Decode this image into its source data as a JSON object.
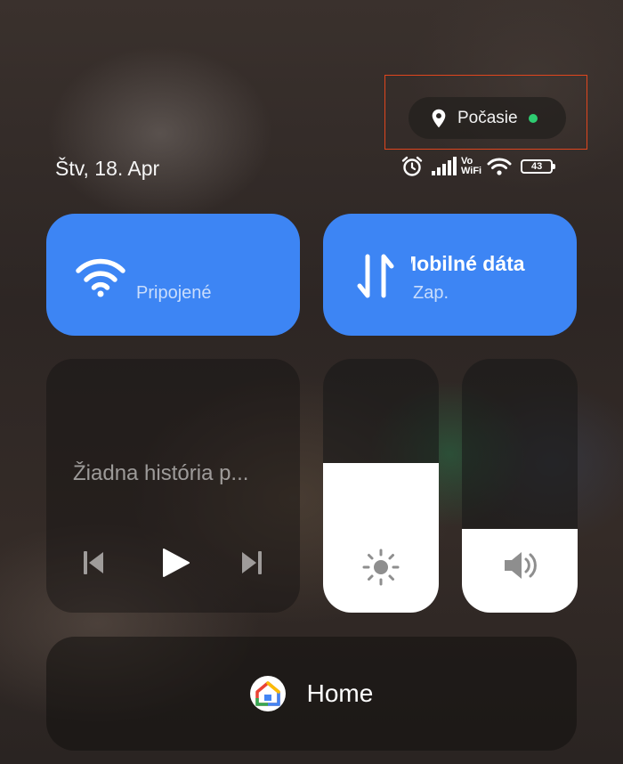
{
  "weather": {
    "label": "Počasie",
    "status_dot_color": "#2ecc71"
  },
  "status_bar": {
    "date": "Štv, 18. Apr",
    "volte_top": "Vo",
    "volte_bottom": "WiFi",
    "battery_level": "43",
    "icons": [
      "alarm-icon",
      "signal-icon",
      "wifi-icon",
      "battery-icon"
    ]
  },
  "tiles": {
    "wifi": {
      "status": "Pripojené",
      "icon": "wifi-icon",
      "color": "#3d85f4"
    },
    "mobile_data": {
      "title": "Mobilné dáta",
      "status": "Zap.",
      "icon": "data-arrows-icon",
      "color": "#3d85f4"
    }
  },
  "media": {
    "title": "Žiadna história p...",
    "controls": [
      "previous-icon",
      "play-icon",
      "next-icon"
    ]
  },
  "sliders": {
    "brightness": {
      "level": 0.59,
      "icon": "sun-icon"
    },
    "volume": {
      "level": 0.33,
      "icon": "speaker-icon"
    }
  },
  "home": {
    "label": "Home",
    "icon": "google-home-icon"
  }
}
